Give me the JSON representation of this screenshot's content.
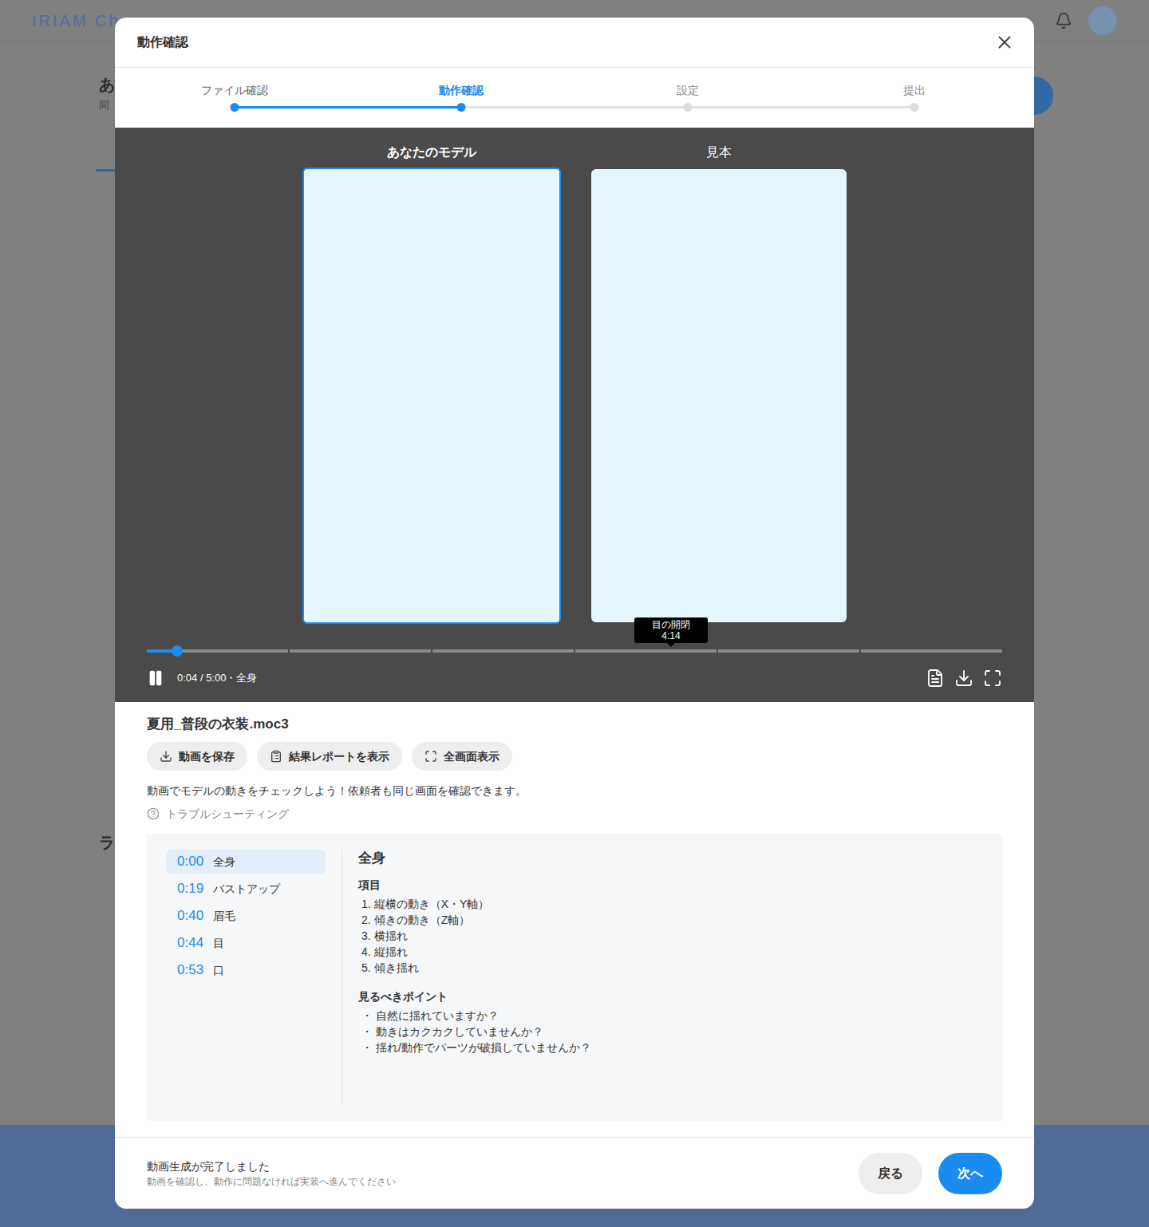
{
  "background": {
    "logo": "IRIAM Cha",
    "heading_fragment": "あ",
    "subtitle_fragment": "同",
    "section_fragment": "ラ"
  },
  "dialog": {
    "title": "動作確認"
  },
  "steps": [
    {
      "label": "ファイル確認",
      "selected": false
    },
    {
      "label": "動作確認",
      "selected": true
    },
    {
      "label": "設定",
      "selected": false
    },
    {
      "label": "提出",
      "selected": false
    }
  ],
  "player": {
    "panels": [
      {
        "label": "あなたのモデル",
        "selected": true
      },
      {
        "label": "見本",
        "selected": false
      }
    ],
    "progress": {
      "level": 0.035,
      "segments": 6
    },
    "tooltip": {
      "title": "目の開閉",
      "time": "4:14"
    },
    "playing": true,
    "time": "0:04 / 5:00・全身"
  },
  "file": {
    "name": "夏用_普段の衣装.moc3"
  },
  "actions": [
    {
      "label": "動画を保存",
      "kind": "download"
    },
    {
      "label": "結果レポートを表示",
      "kind": "report"
    },
    {
      "label": "全画面表示",
      "kind": "fullscreen"
    }
  ],
  "description": "動画でモデルの動きをチェックしよう！依頼者も同じ画面を確認できます。",
  "help": "トラブルシューティング",
  "chapters": [
    {
      "time": "0:00",
      "label": "全身",
      "selected": true
    },
    {
      "time": "0:19",
      "label": "バストアップ",
      "selected": false
    },
    {
      "time": "0:40",
      "label": "眉毛",
      "selected": false
    },
    {
      "time": "0:44",
      "label": "目",
      "selected": false
    },
    {
      "time": "0:53",
      "label": "口",
      "selected": false
    }
  ],
  "detail": {
    "title": "全身",
    "items_heading": "項目",
    "items": [
      {
        "number": "1.",
        "text": "縦横の動き（X・Y軸）"
      },
      {
        "number": "2.",
        "text": "傾きの動き（Z軸）"
      },
      {
        "number": "3.",
        "text": "横揺れ"
      },
      {
        "number": "4.",
        "text": "縦揺れ"
      },
      {
        "number": "5.",
        "text": "傾き揺れ"
      }
    ],
    "points_heading": "見るべきポイント",
    "bullet": "・",
    "points": [
      "自然に揺れていますか？",
      "動きはカクカクしていませんか？",
      "揺れ/動作でパーツが破損していませんか？"
    ]
  },
  "footer": {
    "status": "動画生成が完了しました",
    "hint": "動画を確認し、動作に問題なければ実装へ進んでください",
    "buttons": [
      {
        "label": "戻る",
        "kind": "secondary"
      },
      {
        "label": "次へ",
        "kind": "primary"
      }
    ]
  }
}
